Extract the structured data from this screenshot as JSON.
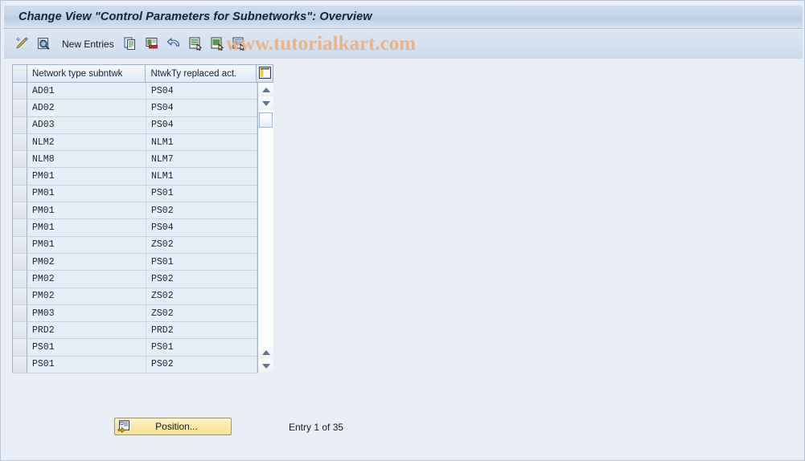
{
  "window": {
    "title": "Change View \"Control Parameters for Subnetworks\": Overview"
  },
  "watermark": {
    "text": "www.tutorialkart.com",
    "color": "#e8b284"
  },
  "toolbar": {
    "items": [
      {
        "name": "display-change-icon",
        "icon": "pencil-icon",
        "label": ""
      },
      {
        "name": "display-icon",
        "icon": "magnifier-document-icon",
        "label": ""
      },
      {
        "name": "new-entries-button",
        "icon": "",
        "label": "New Entries"
      },
      {
        "name": "copy-as-icon",
        "icon": "copy-icon",
        "label": ""
      },
      {
        "name": "delete-icon",
        "icon": "delete-row-icon",
        "label": ""
      },
      {
        "name": "undo-icon",
        "icon": "undo-arrow-icon",
        "label": ""
      },
      {
        "name": "select-all-icon",
        "icon": "select-all-icon",
        "label": ""
      },
      {
        "name": "deselect-all-icon",
        "icon": "deselect-all-icon",
        "label": ""
      },
      {
        "name": "select-block-icon",
        "icon": "select-block-icon",
        "label": ""
      }
    ]
  },
  "table": {
    "config_icon": "table-settings-icon",
    "columns": [
      "Network type subntwk",
      "NtwkTy replaced act."
    ],
    "rows": [
      [
        "AD01",
        "PS04"
      ],
      [
        "AD02",
        "PS04"
      ],
      [
        "AD03",
        "PS04"
      ],
      [
        "NLM2",
        "NLM1"
      ],
      [
        "NLM8",
        "NLM7"
      ],
      [
        "PM01",
        "NLM1"
      ],
      [
        "PM01",
        "PS01"
      ],
      [
        "PM01",
        "PS02"
      ],
      [
        "PM01",
        "PS04"
      ],
      [
        "PM01",
        "ZS02"
      ],
      [
        "PM02",
        "PS01"
      ],
      [
        "PM02",
        "PS02"
      ],
      [
        "PM02",
        "ZS02"
      ],
      [
        "PM03",
        "ZS02"
      ],
      [
        "PRD2",
        "PRD2"
      ],
      [
        "PS01",
        "PS01"
      ],
      [
        "PS01",
        "PS02"
      ]
    ],
    "scrollbar": {
      "up_icon": "scroll-up-arrow-icon",
      "down_icon": "scroll-down-arrow-icon"
    }
  },
  "footer": {
    "position_button_label": "Position...",
    "position_button_icon": "position-goto-icon",
    "entry_counter": "Entry 1 of 35"
  },
  "colors": {
    "background": "#e9eef7",
    "title_bar": "#c3d3e9",
    "row_bg": "#e7eef7",
    "grid_line": "#c6d2e2",
    "border": "#9fb2cc",
    "button_yellow": "#fbe9a8"
  }
}
